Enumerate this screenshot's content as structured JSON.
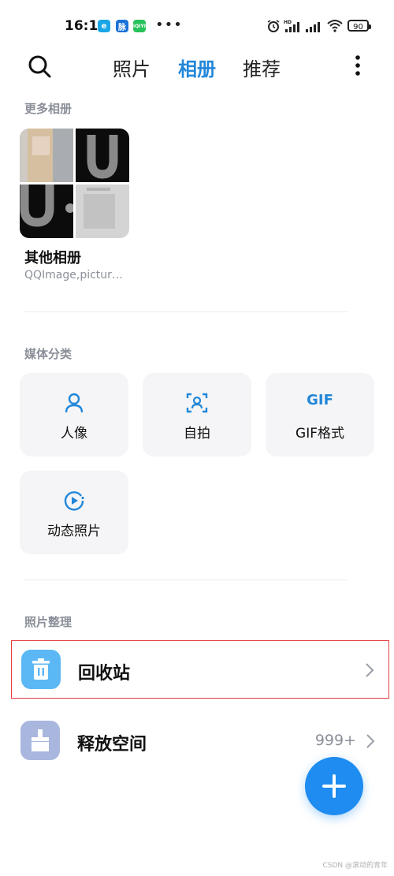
{
  "status_bar": {
    "time": "16:12",
    "app_badges": [
      {
        "text": "e",
        "color": "#1aa6e6"
      },
      {
        "text": "脉",
        "color": "#1a72d8"
      },
      {
        "text": "iQIYI",
        "color": "#26c25a"
      }
    ],
    "overflow": "•••",
    "battery": "90"
  },
  "top_nav": {
    "tabs": [
      {
        "label": "照片",
        "active": false
      },
      {
        "label": "相册",
        "active": true
      },
      {
        "label": "推荐",
        "active": false
      }
    ]
  },
  "more_albums": {
    "title": "更多相册",
    "album": {
      "name": "其他相册",
      "subtitle": "QQImage,pictur…"
    }
  },
  "media_categories": {
    "title": "媒体分类",
    "items": [
      {
        "label": "人像",
        "icon": "person-icon"
      },
      {
        "label": "自拍",
        "icon": "selfie-icon",
        "icon_text": ""
      },
      {
        "label": "GIF格式",
        "icon": "gif-icon",
        "icon_text": "GIF"
      },
      {
        "label": "动态照片",
        "icon": "motion-photo-icon"
      }
    ]
  },
  "photo_organize": {
    "title": "照片整理",
    "items": [
      {
        "label": "回收站",
        "icon": "trash-icon",
        "icon_color": "#5bb8f5",
        "count": ""
      },
      {
        "label": "释放空间",
        "icon": "clean-icon",
        "icon_color": "#a9b7df",
        "count": "999+"
      }
    ]
  },
  "accent_color": "#2287d9",
  "highlight_color": "#e23b3b",
  "watermark": "CSDN @滚动的青年"
}
